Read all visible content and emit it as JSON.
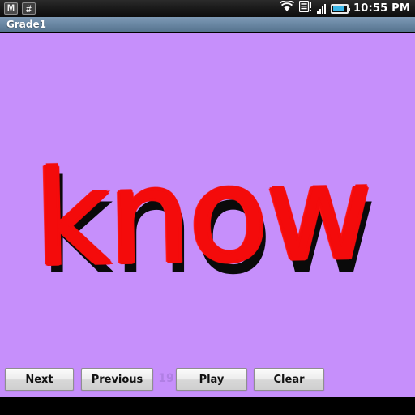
{
  "status_bar": {
    "notifications": [
      {
        "icon": "gmail-icon",
        "glyph": "M"
      },
      {
        "icon": "hash-icon",
        "glyph": "#"
      }
    ],
    "wifi_icon": "wifi-icon",
    "sim_icon": "sim-card-alert-icon",
    "sim_glyph": "!",
    "signal_icon": "signal-bars-icon",
    "battery_icon": "battery-icon",
    "time": "10:55 PM"
  },
  "title_bar": {
    "title": "Grade1"
  },
  "canvas": {
    "word": "know",
    "word_color": "#0a0a0a",
    "tracing_color": "#f40b0b",
    "background_color": "#c68ffb",
    "tracing_word": "know"
  },
  "controls": {
    "next_label": "Next",
    "previous_label": "Previous",
    "counter": "19",
    "play_label": "Play",
    "clear_label": "Clear"
  }
}
